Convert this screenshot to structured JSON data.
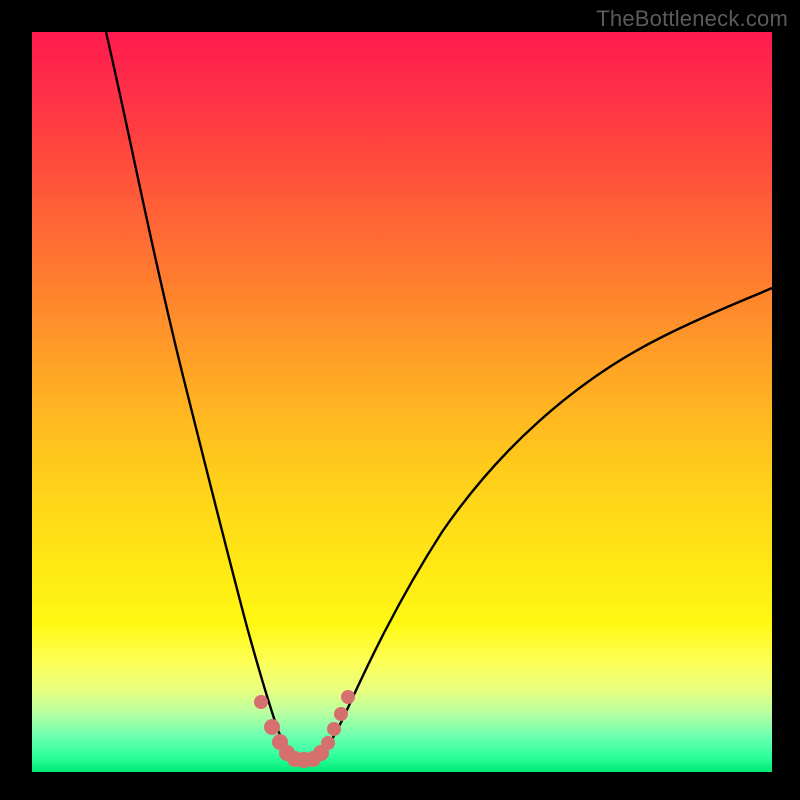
{
  "watermark": "TheBottleneck.com",
  "colors": {
    "frame": "#000000",
    "curve_stroke": "#000000",
    "marker_fill": "#d6706f",
    "marker_stroke": "#b84f4e"
  },
  "chart_data": {
    "type": "line",
    "title": "",
    "xlabel": "",
    "ylabel": "",
    "xlim": [
      0,
      100
    ],
    "ylim": [
      0,
      100
    ],
    "grid": false,
    "series": [
      {
        "name": "left-branch",
        "x": [
          10,
          12,
          15,
          18,
          22,
          25,
          28,
          30,
          32,
          34
        ],
        "y": [
          100,
          90,
          76,
          62,
          44,
          30,
          16,
          8,
          3,
          1
        ]
      },
      {
        "name": "right-branch",
        "x": [
          38,
          40,
          43,
          48,
          55,
          65,
          78,
          90,
          100
        ],
        "y": [
          1,
          4,
          10,
          20,
          33,
          46,
          56,
          62,
          66
        ]
      },
      {
        "name": "markers",
        "x": [
          31.0,
          32.5,
          33.5,
          34.5,
          35.5,
          36.5,
          37.5,
          38.5,
          39.5,
          40.3,
          41.2,
          42.0
        ],
        "y": [
          9.5,
          6.0,
          4.0,
          2.6,
          2.0,
          2.0,
          2.0,
          2.6,
          4.0,
          6.0,
          8.0,
          10.0
        ]
      }
    ],
    "annotations": []
  }
}
